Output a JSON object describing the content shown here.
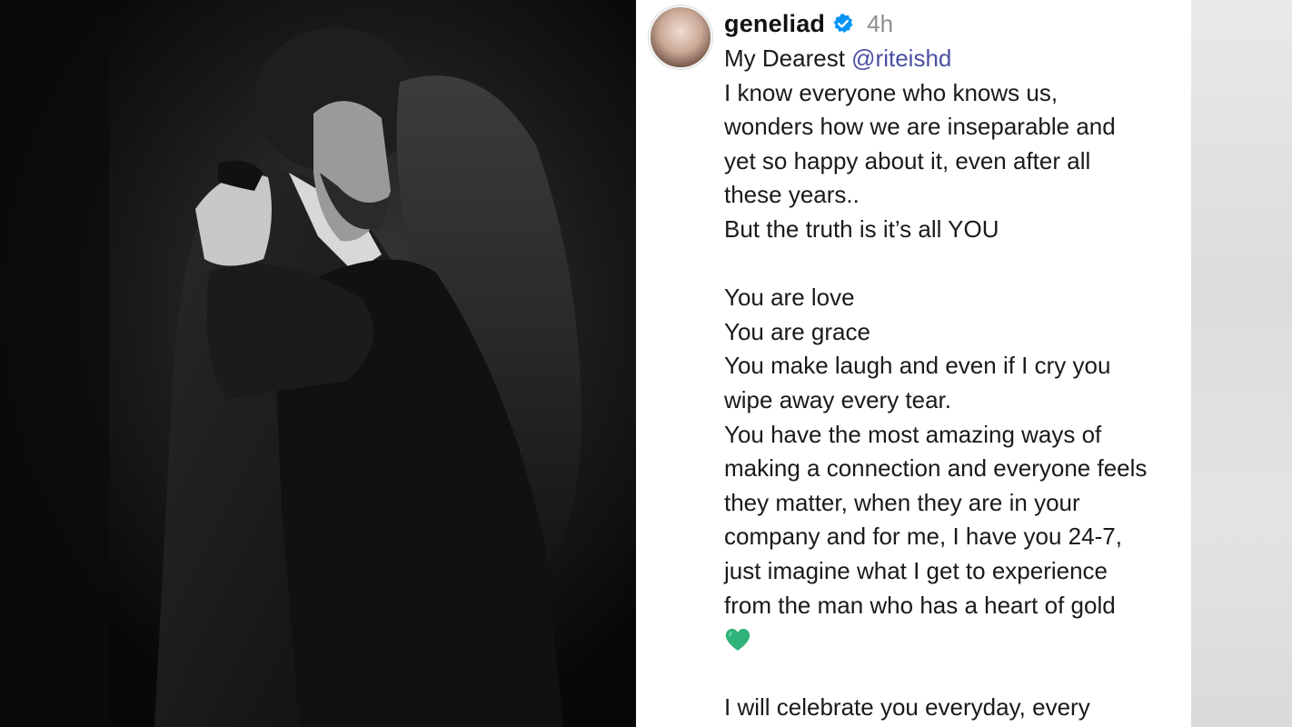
{
  "post": {
    "username": "geneliad",
    "time": "4h",
    "caption": {
      "greeting": "My Dearest",
      "mention": "@riteishd",
      "lines": [
        "I know everyone who knows us,",
        "wonders how we are inseparable and",
        "yet so happy about it, even after all",
        "these years..",
        "But the truth is it’s all YOU"
      ],
      "lines2": [
        "You are love",
        "You are grace",
        "You make laugh and even if I cry you",
        "wipe away every tear.",
        "You have the most amazing ways of",
        "making a connection and everyone feels",
        "they matter, when they are in your",
        "company and for me, I have you 24-7,",
        "just imagine what I get to experience",
        "from the man who has a heart of gold"
      ],
      "emoji": "green-heart",
      "last_line": "I will celebrate you everyday, every"
    }
  },
  "colors": {
    "mention": "#4a4fa3",
    "verified": "#0095f6",
    "heart": "#2fb37a"
  }
}
